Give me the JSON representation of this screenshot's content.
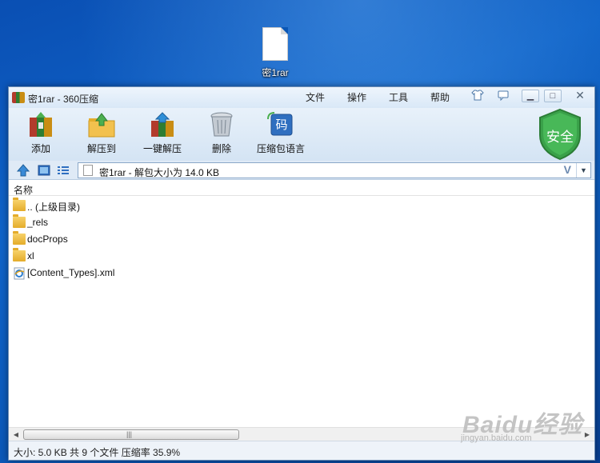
{
  "desktop": {
    "icon_label": "密1rar"
  },
  "window": {
    "title": "密1rar - 360压缩",
    "menu": [
      "文件",
      "操作",
      "工具",
      "帮助"
    ]
  },
  "toolbar": {
    "buttons": [
      {
        "label": "添加",
        "icon": "add-archive-icon"
      },
      {
        "label": "解压到",
        "icon": "extract-to-icon"
      },
      {
        "label": "一键解压",
        "icon": "one-click-extract-icon"
      },
      {
        "label": "删除",
        "icon": "delete-icon"
      },
      {
        "label": "压缩包语言",
        "icon": "archive-language-icon"
      }
    ],
    "language_glyph": "码",
    "shield_label": "安全"
  },
  "address": {
    "path": "密1rar - 解包大小为 14.0 KB",
    "v_badge": "V"
  },
  "list": {
    "column_name": "名称",
    "rows": [
      {
        "name": ".. (上级目录)",
        "type": "folder"
      },
      {
        "name": "_rels",
        "type": "folder"
      },
      {
        "name": "docProps",
        "type": "folder"
      },
      {
        "name": "xl",
        "type": "folder"
      },
      {
        "name": "[Content_Types].xml",
        "type": "xml"
      }
    ]
  },
  "status": {
    "text": "大小: 5.0 KB 共 9 个文件 压缩率 35.9%"
  },
  "watermark": {
    "main": "Baidu经验",
    "sub": "jingyan.baidu.com"
  },
  "colors": {
    "desktop": "#0f63c8",
    "shield": "#3aa14a",
    "accent": "#2f6fc0"
  }
}
